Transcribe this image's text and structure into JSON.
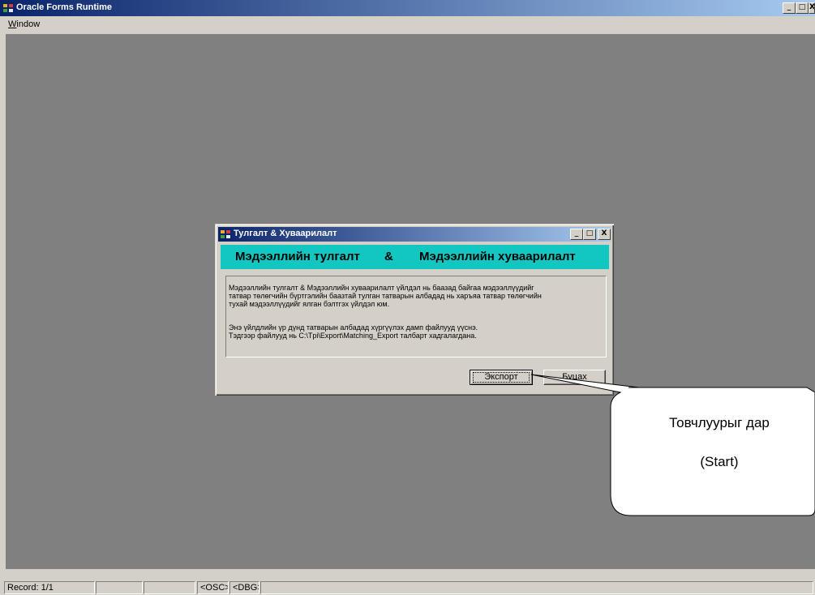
{
  "app": {
    "title": "Oracle Forms Runtime",
    "controls": {
      "minimize": "_",
      "maximize": "□",
      "close": "X"
    }
  },
  "menubar": {
    "items": [
      {
        "label": "Window",
        "mnemonic": "W",
        "rest": "indow"
      }
    ]
  },
  "dialog": {
    "title": "Тулгалт & Хуваарилалт",
    "controls": {
      "minimize": "_",
      "maximize": "□",
      "close": "X"
    },
    "banner": {
      "left": "Мэдээллийн тулгалт",
      "amp": "&",
      "right": "Мэдээллийн хуваарилалт"
    },
    "description": [
      "Мэдээллийн тулгалт & Мэдээллийн хуваарилалт үйлдэл нь баазад байгаа мэдээллүүдийг",
      "татвар төлөгчийн бүртгэлийн баазтай тулган татварын албадад нь харъяа татвар төлөгчийн",
      "тухай мэдээллүүдийг ялган бэлтгэх үйлдэл юм.",
      "Энэ үйлдлийн үр дүнд татварын албадад хүргүүлэх дамп файлууд үүснэ.",
      "Тэдгээр файлууд нь C:\\Tpi\\Export\\Matching_Export талбарт хадгалагдана."
    ],
    "buttons": {
      "export": "Экспорт",
      "back": "Буцах"
    }
  },
  "callout": {
    "line1": "Товчлуурыг дар",
    "line2": "(Start)"
  },
  "statusbar": {
    "record": "Record: 1/1",
    "osc": "<OSC>",
    "dbg": "<DBG>"
  },
  "colors": {
    "title_gradient_start": "#0a246a",
    "title_gradient_end": "#a6caf0",
    "banner": "#12c7c1",
    "workspace": "#808080",
    "chrome": "#d4d0c8"
  }
}
